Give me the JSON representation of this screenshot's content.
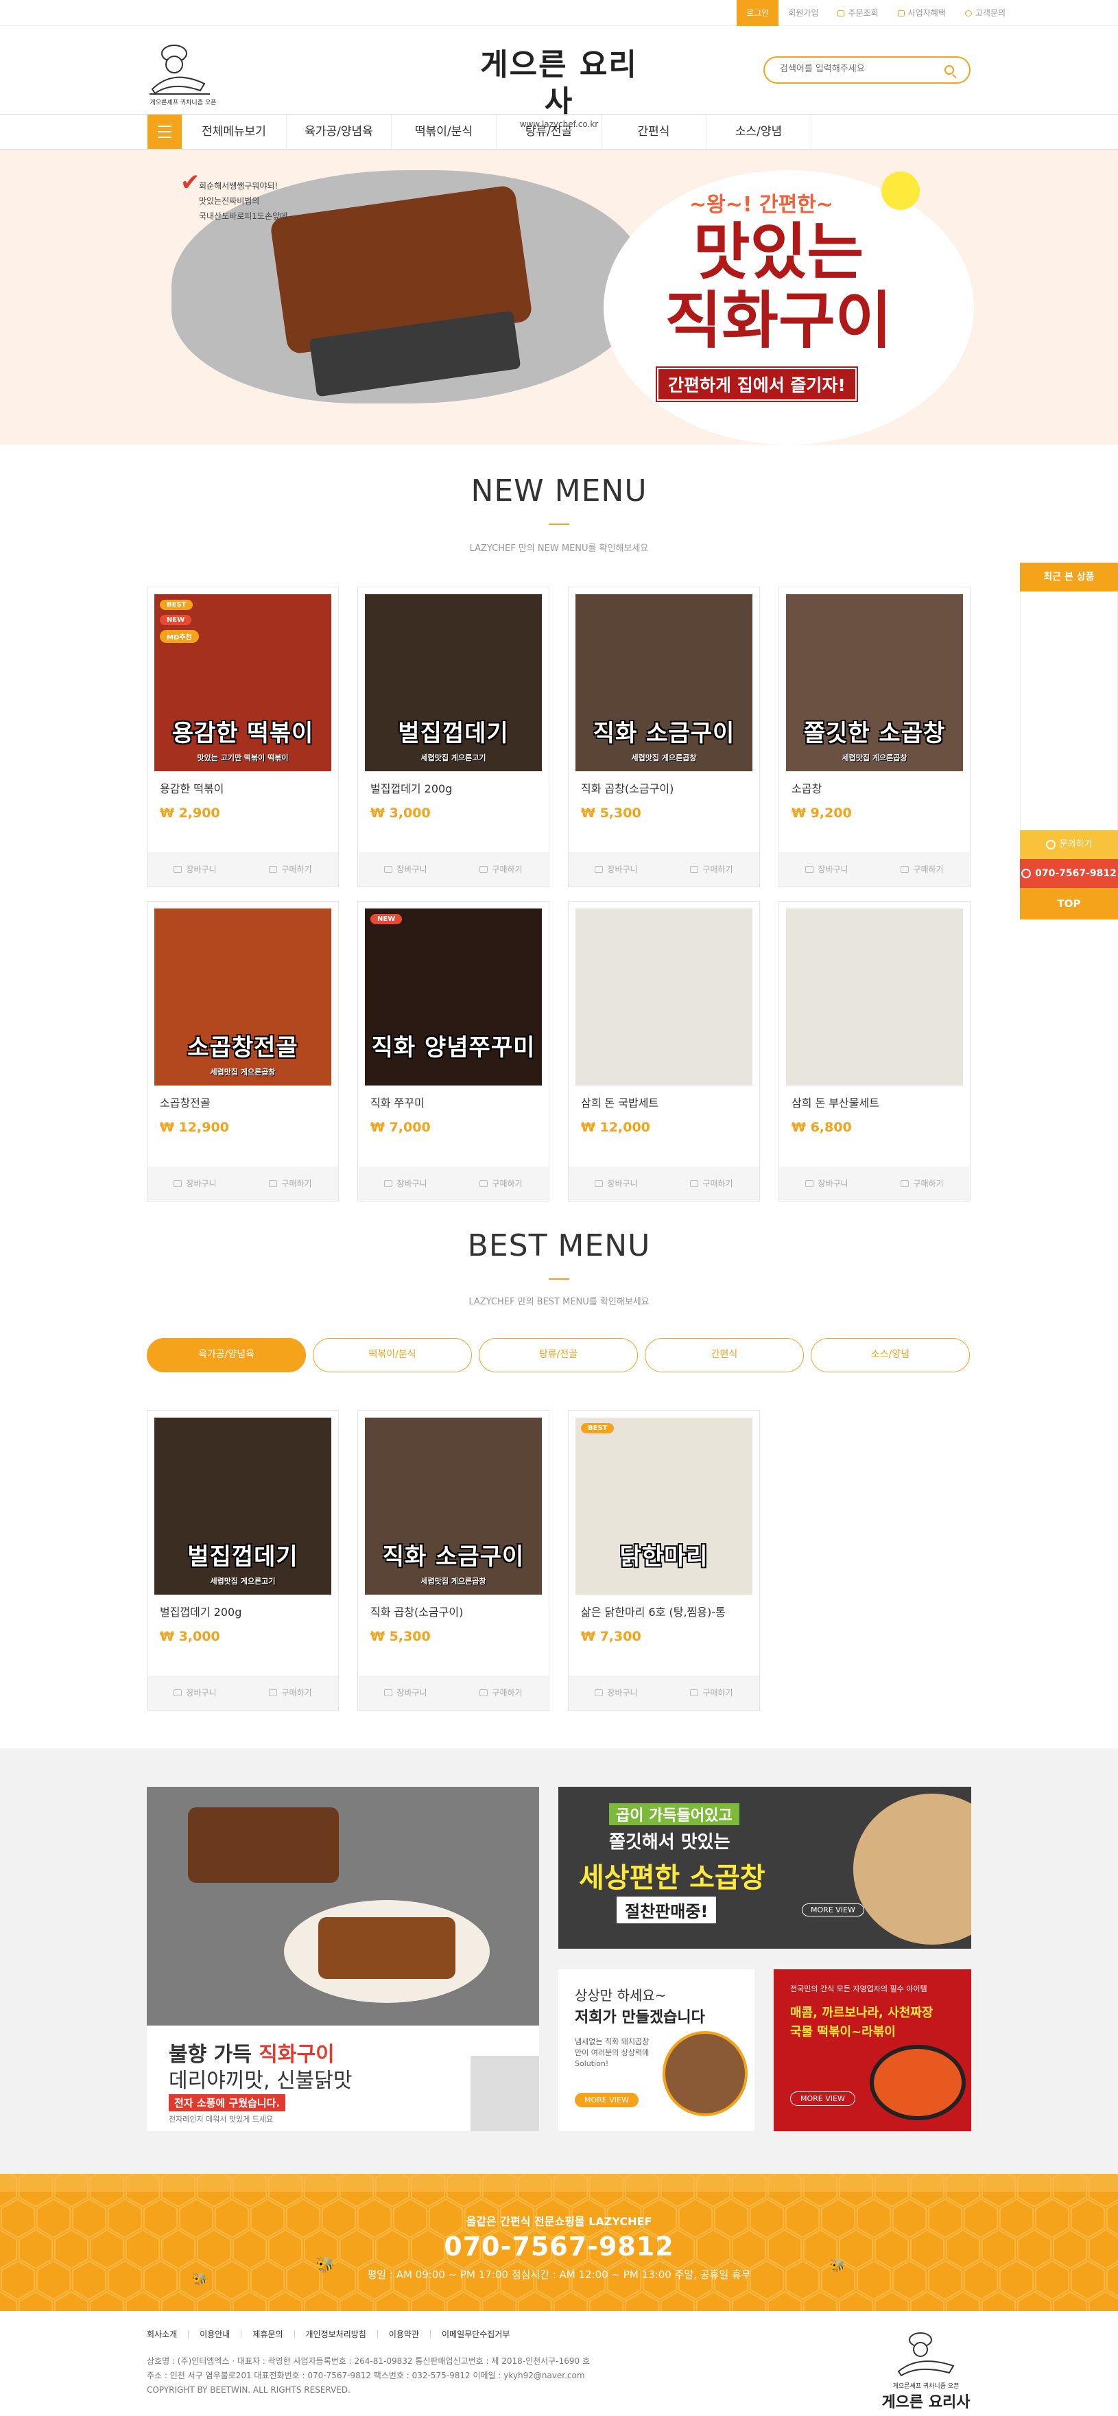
{
  "topbar": {
    "links": [
      {
        "label": "로그인",
        "icon": "",
        "on": true
      },
      {
        "label": "회원가입",
        "icon": "",
        "on": false
      },
      {
        "label": "주문조회",
        "icon": "cart-icon",
        "on": false
      },
      {
        "label": "사업자혜택",
        "icon": "briefcase-icon",
        "on": false
      },
      {
        "label": "고객문의",
        "icon": "chat-icon",
        "on": false
      }
    ]
  },
  "header": {
    "logo_small_text": "게으른셰프  귀차니즘 오픈",
    "logo_title": "게으른 요리사",
    "logo_url": "www.lazychef.co.kr",
    "search_placeholder": "검색어를 입력해주세요"
  },
  "nav": {
    "items": [
      "전체메뉴보기",
      "육가공/양념육",
      "떡볶이/분식",
      "탕류/전골",
      "간편식",
      "소스/양념"
    ]
  },
  "hero": {
    "notes": [
      "회순해서쌩쌩구워야되!",
      "맛있는진짜비법의",
      "국내산도바로피1도손앞에"
    ],
    "check": "✔",
    "subtitle": "~왕~! 간편한~",
    "title_line1": "맛있는",
    "title_line2": "직화구이",
    "tagline": "간편하게 집에서 즐기자!"
  },
  "new_menu": {
    "title": "NEW MENU",
    "subtitle": "LAZYCHEF 만의 NEW MENU를 확인해보세요",
    "products": [
      {
        "name": "용감한 떡볶이",
        "price": "₩ 2,900",
        "caption": "용감한 떡볶이",
        "subcap": "맛있는 고기만 떡볶이 떡볶이",
        "badges": [
          "BEST",
          "NEW",
          "MD추천"
        ],
        "bg": "#a5301e"
      },
      {
        "name": "벌집껍데기 200g",
        "price": "₩ 3,000",
        "caption": "벌집껍데기",
        "subcap": "세렵맛집 게으른고기",
        "badges": [],
        "bg": "#3b2d22"
      },
      {
        "name": "직화 곱창(소금구이)",
        "price": "₩ 5,300",
        "caption": "직화 소금구이",
        "subcap": "세렵맛집 게으른곱창",
        "badges": [],
        "bg": "#5a4536"
      },
      {
        "name": "소곱창",
        "price": "₩ 9,200",
        "caption": "쫄깃한 소곱창",
        "subcap": "세렵맛집 게으른곱창",
        "badges": [],
        "bg": "#6b5142"
      },
      {
        "name": "소곱창전골",
        "price": "₩ 12,900",
        "caption": "소곱창전골",
        "subcap": "세렵맛집 게으른곱창",
        "badges": [],
        "bg": "#b3481e"
      },
      {
        "name": "직화 쭈꾸미",
        "price": "₩ 7,000",
        "caption": "직화 양념쭈꾸미",
        "subcap": "",
        "badges": [
          "NEW"
        ],
        "bg": "#2b1a14"
      },
      {
        "name": "삼희 돈 국밥세트",
        "price": "₩ 12,000",
        "caption": "",
        "subcap": "",
        "badges": [],
        "bg": "#e8e4de"
      },
      {
        "name": "삼희 돈 부산물세트",
        "price": "₩ 6,800",
        "caption": "",
        "subcap": "",
        "badges": [],
        "bg": "#e8e4de"
      }
    ],
    "cart_label": "장바구니",
    "buy_label": "구매하기"
  },
  "best_menu": {
    "title": "BEST MENU",
    "subtitle": "LAZYCHEF 만의 BEST MENU를 확인해보세요",
    "tabs": [
      "육가공/양념육",
      "떡볶이/분식",
      "탕류/전골",
      "간편식",
      "소스/양념"
    ],
    "active_tab": 0,
    "products": [
      {
        "name": "벌집껍데기 200g",
        "price": "₩ 3,000",
        "caption": "벌집껍데기",
        "subcap": "세렵맛집 게으른고기",
        "badges": [],
        "bg": "#3b2d22"
      },
      {
        "name": "직화 곱창(소금구이)",
        "price": "₩ 5,300",
        "caption": "직화 소금구이",
        "subcap": "세렵맛집 게으른곱창",
        "badges": [],
        "bg": "#5a4536"
      },
      {
        "name": "삶은 닭한마리 6호 (탕,찜용)-통",
        "price": "₩ 7,300",
        "caption": "닭한마리",
        "subcap": "",
        "badges": [
          "BEST"
        ],
        "bg": "#e9e4da"
      }
    ]
  },
  "quick": {
    "header": "최근 본 상품",
    "chat": "문의하기",
    "phone": "070-7567-9812",
    "top": "TOP"
  },
  "banners": {
    "b1_line1_prefix": "불향 가득 ",
    "b1_line1_strong": "직화구이",
    "b1_line2": "데리야끼맛, 신불닭맛",
    "b1_line3": "전자 소풍에 구웠습니다.",
    "b1_line4": "전자레인지 데워서 맛있게 드세요",
    "b2_line1": "곱이 가득들어있고",
    "b2_line2": "쫄깃해서 맛있는",
    "b2_line3": "세상편한 소곱창",
    "b2_line4": "절찬판매중!",
    "b2_more": "MORE VIEW",
    "b3_line1": "상상만 하세요~",
    "b3_line2": "저희가 만들겠습니다",
    "b3_line3": "냄새없는 직화 돼지곱창만이 여러분의 상상력에 Solution!",
    "b3_more": "MORE VIEW",
    "b4_line1": "전국민의 간식 모든 자영업자의 필수 아이템",
    "b4_line2": "매콤, 까르보나라, 사천짜장",
    "b4_line3": "국물 떡볶이~라볶이",
    "b4_more": "MORE VIEW"
  },
  "contact": {
    "tagline": "올같은 간편식 전문쇼핑몰 LAZYCHEF",
    "phone": "070-7567-9812",
    "hours": "평일 : AM 09:00 ~ PM 17:00   점심시간 : AM 12:00 ~ PM 13:00   주말, 공휴일 휴무"
  },
  "footer": {
    "menu": [
      "회사소개",
      "이용안내",
      "제휴문의",
      "개인정보처리방침",
      "이용약관",
      "이메일무단수집거부"
    ],
    "line1": "상호명 : (주)인터엠엑스 · 대표자 : 곽영한   사업자등록번호 : 264-81-09832   통신판매업신고번호 : 제 2018-인천서구-1690 호",
    "line2": "주소 : 인천 서구 염우불로201   대표전화번호 : 070-7567-9812   팩스번호 : 032-575-9812   이메일 : ykyh92@naver.com",
    "line3": "COPYRIGHT BY BEETWIN. ALL RIGHTS RESERVED.",
    "logo_text": "게으른 요리사",
    "logo_small_text": "게으른셰프  귀차니즘 오픈"
  },
  "colors": {
    "accent": "#f5a31a",
    "red": "#e84a33",
    "dark_red": "#b11818"
  }
}
